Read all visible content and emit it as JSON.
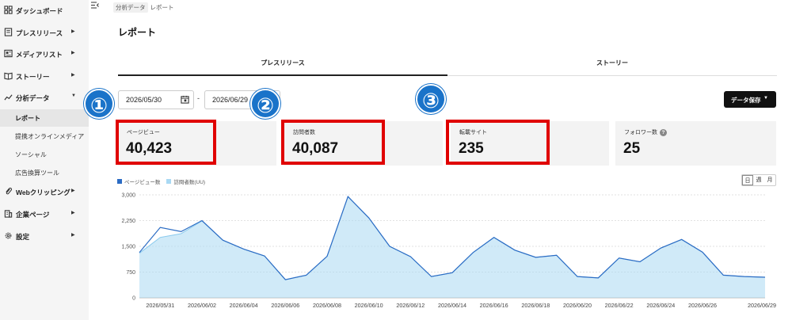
{
  "sidebar": {
    "items": [
      {
        "label": "ダッシュボード",
        "icon": "grid-icon",
        "chevron": ""
      },
      {
        "label": "プレスリリース",
        "icon": "document-icon",
        "chevron": "▶"
      },
      {
        "label": "メディアリスト",
        "icon": "newspaper-icon",
        "chevron": "▶"
      },
      {
        "label": "ストーリー",
        "icon": "book-icon",
        "chevron": "▶"
      },
      {
        "label": "分析データ",
        "icon": "chart-line-icon",
        "chevron": "▼"
      },
      {
        "label": "Webクリッピング",
        "icon": "paperclip-icon",
        "chevron": "▶"
      },
      {
        "label": "企業ページ",
        "icon": "building-icon",
        "chevron": "▶"
      },
      {
        "label": "設定",
        "icon": "gear-icon",
        "chevron": "▶"
      }
    ],
    "subitems": [
      {
        "label": "レポート",
        "active": true
      },
      {
        "label": "提携オンラインメディア",
        "active": false
      },
      {
        "label": "ソーシャル",
        "active": false
      },
      {
        "label": "広告換算ツール",
        "active": false
      }
    ]
  },
  "header": {
    "collapse_icon": "collapse-menu-icon",
    "breadcrumb": [
      "分析データ",
      "レポート"
    ]
  },
  "page": {
    "title": "レポート",
    "tabs": [
      "プレスリリース",
      "ストーリー"
    ],
    "date_start": "2026/05/30",
    "date_end": "2026/06/29",
    "date_separator": "-",
    "export_label": "データ保存",
    "export_caret": "▼"
  },
  "metrics": [
    {
      "label": "ページビュー",
      "value": "40,423"
    },
    {
      "label": "訪問者数",
      "value": "40,087"
    },
    {
      "label": "転載サイト",
      "value": "235"
    },
    {
      "label": "フォロワー数",
      "value": "25",
      "help": "?"
    }
  ],
  "annotations": [
    "①",
    "②",
    "③"
  ],
  "annotation_color": "#e00000",
  "annotation_badge_color": "#1a73c9",
  "granularity": {
    "options": [
      "日",
      "週",
      "月"
    ],
    "selected": "日"
  },
  "chart_data": {
    "type": "area",
    "x": [
      "2026/05/30",
      "2026/05/31",
      "2026/06/01",
      "2026/06/02",
      "2026/06/03",
      "2026/06/04",
      "2026/06/05",
      "2026/06/06",
      "2026/06/07",
      "2026/06/08",
      "2026/06/09",
      "2026/06/10",
      "2026/06/11",
      "2026/06/12",
      "2026/06/13",
      "2026/06/14",
      "2026/06/15",
      "2026/06/16",
      "2026/06/17",
      "2026/06/18",
      "2026/06/19",
      "2026/06/20",
      "2026/06/21",
      "2026/06/22",
      "2026/06/23",
      "2026/06/24",
      "2026/06/25",
      "2026/06/26",
      "2026/06/27",
      "2026/06/28",
      "2026/06/29"
    ],
    "x_tick_labels": [
      "2026/05/31",
      "2026/06/02",
      "2026/06/04",
      "2026/06/06",
      "2026/06/08",
      "2026/06/10",
      "2026/06/12",
      "2026/06/14",
      "2026/06/16",
      "2026/06/18",
      "2026/06/20",
      "2026/06/22",
      "2026/06/24",
      "2026/06/26",
      "2026/06/29"
    ],
    "x_tick_indices": [
      1,
      3,
      5,
      7,
      9,
      11,
      13,
      15,
      17,
      19,
      21,
      23,
      25,
      27,
      30
    ],
    "y_ticks": [
      "0",
      "750",
      "1,500",
      "2,250",
      "3,000"
    ],
    "ylim": [
      0,
      3000
    ],
    "grid": true,
    "legend_position": "top-left",
    "series": [
      {
        "name": "ページビュー数",
        "color": "#2b6cc4",
        "values": [
          1320,
          2050,
          1930,
          2250,
          1680,
          1420,
          1220,
          530,
          660,
          1210,
          2950,
          2330,
          1500,
          1200,
          620,
          730,
          1320,
          1760,
          1390,
          1180,
          1240,
          620,
          580,
          1160,
          1050,
          1450,
          1700,
          1330,
          660,
          620,
          600
        ]
      },
      {
        "name": "訪問者数(UU)",
        "color": "#a9d9f3",
        "values": [
          1300,
          1760,
          1870,
          2240,
          1680,
          1420,
          1220,
          530,
          660,
          1210,
          2950,
          2330,
          1500,
          1200,
          620,
          730,
          1320,
          1760,
          1390,
          1180,
          1240,
          620,
          580,
          1160,
          1050,
          1450,
          1700,
          1330,
          660,
          620,
          600
        ]
      }
    ]
  }
}
